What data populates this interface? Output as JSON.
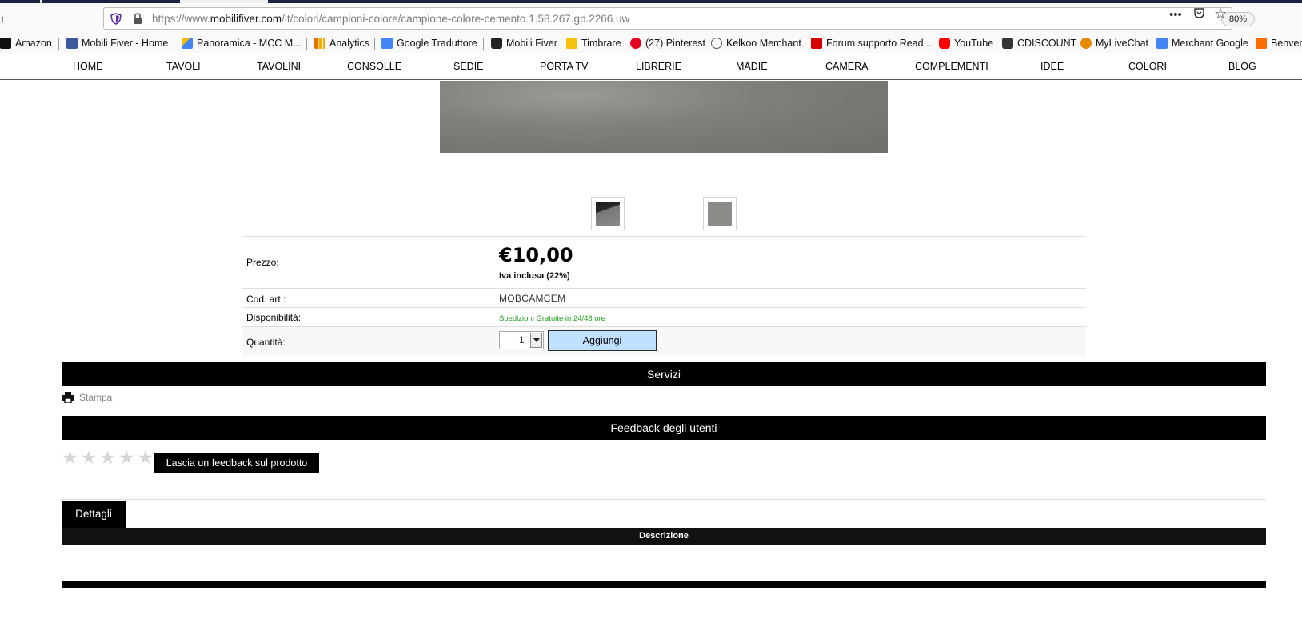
{
  "browser": {
    "url_prefix": "https://www.",
    "url_domain": "mobilifiver.com",
    "url_path": "/it/colori/campioni-colore/campione-colore-cemento.1.58.267.gp.2266.uw",
    "zoom": "80%",
    "more_icon": "•••",
    "pocket_icon": "☐",
    "star_icon": "☆"
  },
  "bookmarks": [
    {
      "label": "Amazon",
      "color": "#111111"
    },
    {
      "label": "Mobili Fiver - Home",
      "color": "#3b5998"
    },
    {
      "label": "Panoramica - MCC M...",
      "color": "#4285f4"
    },
    {
      "label": "Analytics",
      "color": "#f9ab00"
    },
    {
      "label": "Google Traduttore",
      "color": "#4285f4"
    },
    {
      "label": "Mobili Fiver",
      "color": "#222222"
    },
    {
      "label": "Timbrare",
      "color": "#f4c20d"
    },
    {
      "label": "(27) Pinterest",
      "color": "#e60023"
    },
    {
      "label": "Kelkoo Merchant",
      "color": "#555555"
    },
    {
      "label": "Forum supporto Read...",
      "color": "#d60000"
    },
    {
      "label": "YouTube",
      "color": "#ff0000"
    },
    {
      "label": "CDISCOUNT",
      "color": "#333333"
    },
    {
      "label": "MyLiveChat",
      "color": "#e68a00"
    },
    {
      "label": "Merchant Google",
      "color": "#4285f4"
    },
    {
      "label": "Benven",
      "color": "#ff6d00"
    }
  ],
  "menu": [
    "HOME",
    "TAVOLI",
    "TAVOLINI",
    "CONSOLLE",
    "SEDIE",
    "PORTA TV",
    "LIBRERIE",
    "MADIE",
    "CAMERA",
    "COMPLEMENTI",
    "IDEE",
    "COLORI",
    "BLOG"
  ],
  "product": {
    "price_label": "Prezzo:",
    "price": "€10,00",
    "vat": "Iva inclusa (22%)",
    "code_label": "Cod. art.:",
    "code": "MOBCAMCEM",
    "availability_label": "Disponibilità:",
    "availability": "Spedizioni Gratuite in 24/48 ore",
    "quantity_label": "Quantità:",
    "quantity": "1",
    "add_label": "Aggiungi"
  },
  "services": {
    "title": "Servizi",
    "print_label": "Stampa"
  },
  "feedback": {
    "title": "Feedback degli utenti",
    "rating_stars": 0,
    "button_label": "Lascia un feedback sul prodotto"
  },
  "details": {
    "tab_label": "Dettagli",
    "description_title": "Descrizione"
  }
}
